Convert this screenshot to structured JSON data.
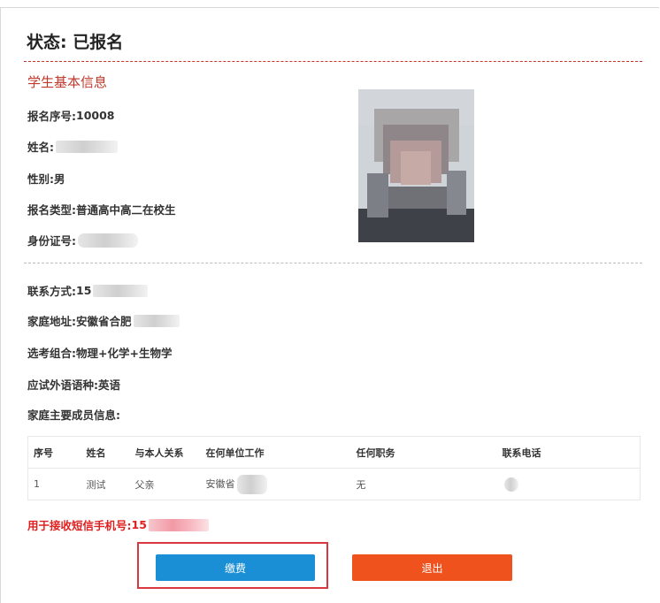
{
  "header": {
    "status_label": "状态: ",
    "status_value": "已报名"
  },
  "student_info": {
    "section_title": "学生基本信息",
    "reg_no_label": "报名序号: ",
    "reg_no_value": "10008",
    "name_label": "姓名: ",
    "gender_label": "性别: ",
    "gender_value": "男",
    "reg_type_label": "报名类型: ",
    "reg_type_value": "普通高中高二在校生",
    "id_label": "身份证号: "
  },
  "contact": {
    "phone_label": "联系方式: ",
    "phone_value_visible": "15",
    "address_label": "家庭地址: ",
    "address_value_visible": "安徽省合肥",
    "subjects_label": "选考组合: ",
    "subjects_value": "物理+化学+生物学",
    "language_label": "应试外语语种: ",
    "language_value": "英语",
    "family_label": "家庭主要成员信息:"
  },
  "family_table": {
    "columns": [
      "序号",
      "姓名",
      "与本人关系",
      "在何单位工作",
      "任何职务",
      "联系电话"
    ],
    "rows": [
      [
        "1",
        "测试",
        "父亲",
        "安徽省",
        "无",
        ""
      ]
    ]
  },
  "sms": {
    "label": "用于接收短信手机号: ",
    "value_visible": "15"
  },
  "actions": {
    "pay_label": "缴费",
    "exit_label": "退出"
  },
  "colors": {
    "accent_red": "#c0392b",
    "pay_blue": "#1a8fd6",
    "exit_orange": "#f0521e",
    "highlight_red": "#d9383f"
  }
}
